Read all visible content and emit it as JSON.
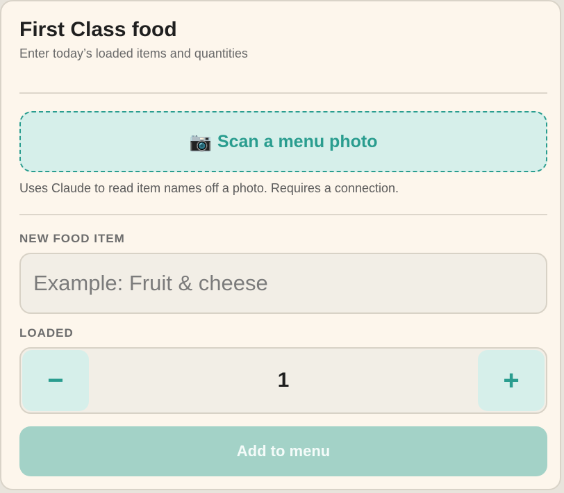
{
  "header": {
    "title": "First Class food",
    "subtitle": "Enter today’s loaded items and quantities"
  },
  "scan": {
    "icon": "camera-icon",
    "icon_glyph": "📷",
    "label": "Scan a menu photo",
    "note": "Uses Claude to read item names off a photo. Requires a connection."
  },
  "food_item": {
    "label": "NEW FOOD ITEM",
    "placeholder": "Example: Fruit & cheese",
    "value": ""
  },
  "loaded": {
    "label": "LOADED",
    "minus_glyph": "−",
    "plus_glyph": "+",
    "value": "1"
  },
  "actions": {
    "add_label": "Add to menu"
  },
  "colors": {
    "accent": "#2a9d8f",
    "panel_bg": "#fdf6ec",
    "accent_soft": "#d6efea",
    "add_button_disabled": "#a3d2c7"
  }
}
